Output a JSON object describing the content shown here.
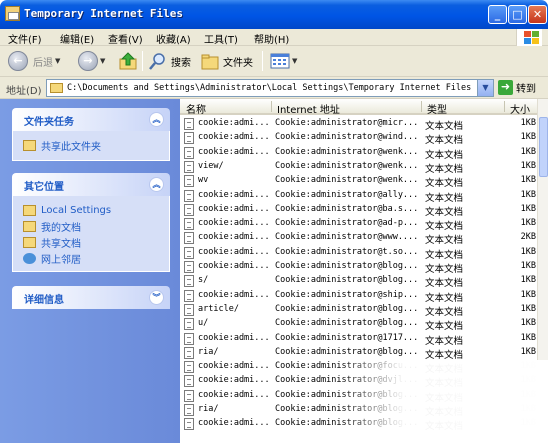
{
  "window": {
    "title": "Temporary Internet Files"
  },
  "menu": [
    "文件(F)",
    "编辑(E)",
    "查看(V)",
    "收藏(A)",
    "工具(T)",
    "帮助(H)"
  ],
  "toolbar": {
    "back": "后退",
    "search": "搜索",
    "folders": "文件夹"
  },
  "address": {
    "label": "地址(D)",
    "value": "C:\\Documents and Settings\\Administrator\\Local Settings\\Temporary Internet Files",
    "go": "转到"
  },
  "tasks_panel": {
    "title": "文件夹任务",
    "items": [
      "共享此文件夹"
    ]
  },
  "places_panel": {
    "title": "其它位置",
    "items": [
      "Local Settings",
      "我的文档",
      "共享文档",
      "网上邻居"
    ]
  },
  "details_panel": {
    "title": "详细信息"
  },
  "columns": {
    "name": "名称",
    "address": "Internet 地址",
    "type": "类型",
    "size": "大小"
  },
  "files": [
    {
      "name": "cookie:admi...",
      "address": "Cookie:administrator@micr...",
      "type": "文本文档",
      "size": "1KB"
    },
    {
      "name": "cookie:admi...",
      "address": "Cookie:administrator@wind...",
      "type": "文本文档",
      "size": "1KB"
    },
    {
      "name": "cookie:admi...",
      "address": "Cookie:administrator@wenk...",
      "type": "文本文档",
      "size": "1KB"
    },
    {
      "name": "view/",
      "address": "Cookie:administrator@wenk...",
      "type": "文本文档",
      "size": "1KB"
    },
    {
      "name": "wv",
      "address": "Cookie:administrator@wenk...",
      "type": "文本文档",
      "size": "1KB"
    },
    {
      "name": "cookie:admi...",
      "address": "Cookie:administrator@ally...",
      "type": "文本文档",
      "size": "1KB"
    },
    {
      "name": "cookie:admi...",
      "address": "Cookie:administrator@ba.s...",
      "type": "文本文档",
      "size": "1KB"
    },
    {
      "name": "cookie:admi...",
      "address": "Cookie:administrator@ad-p...",
      "type": "文本文档",
      "size": "1KB"
    },
    {
      "name": "cookie:admi...",
      "address": "Cookie:administrator@www....",
      "type": "文本文档",
      "size": "2KB"
    },
    {
      "name": "cookie:admi...",
      "address": "Cookie:administrator@t.so...",
      "type": "文本文档",
      "size": "1KB"
    },
    {
      "name": "cookie:admi...",
      "address": "Cookie:administrator@blog...",
      "type": "文本文档",
      "size": "1KB"
    },
    {
      "name": "s/",
      "address": "Cookie:administrator@blog...",
      "type": "文本文档",
      "size": "1KB"
    },
    {
      "name": "cookie:admi...",
      "address": "Cookie:administrator@ship...",
      "type": "文本文档",
      "size": "1KB"
    },
    {
      "name": "article/",
      "address": "Cookie:administrator@blog...",
      "type": "文本文档",
      "size": "1KB"
    },
    {
      "name": "u/",
      "address": "Cookie:administrator@blog...",
      "type": "文本文档",
      "size": "1KB"
    },
    {
      "name": "cookie:admi...",
      "address": "Cookie:administrator@1717...",
      "type": "文本文档",
      "size": "1KB"
    },
    {
      "name": "ria/",
      "address": "Cookie:administrator@blog...",
      "type": "文本文档",
      "size": "1KB"
    },
    {
      "name": "cookie:admi...",
      "address": "Cookie:administrator@focu...",
      "type": "文本文档",
      "size": "1KB"
    },
    {
      "name": "cookie:admi...",
      "address": "Cookie:administrator@dvjl...",
      "type": "文本文档",
      "size": "1KB"
    },
    {
      "name": "cookie:admi...",
      "address": "Cookie:administrator@blog...",
      "type": "文本文档",
      "size": "1KB"
    },
    {
      "name": "ria/",
      "address": "Cookie:administrator@blog...",
      "type": "文本文档",
      "size": "1KB"
    },
    {
      "name": "cookie:admi...",
      "address": "Cookie:administrator@blog...",
      "type": "文本文档",
      "size": "1KB"
    }
  ]
}
